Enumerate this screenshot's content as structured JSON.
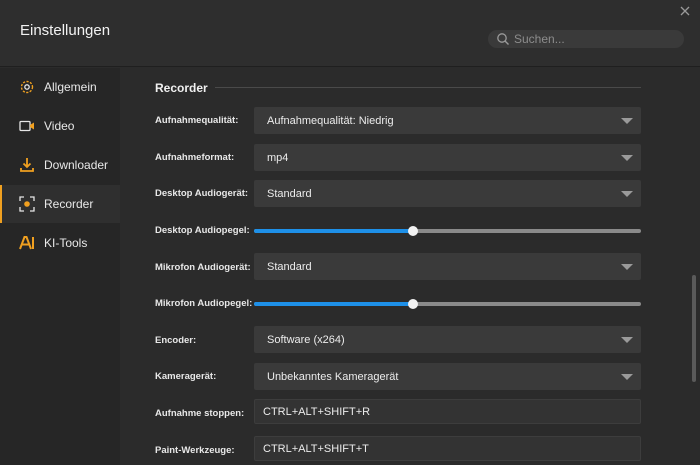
{
  "window": {
    "title": "Einstellungen"
  },
  "search": {
    "placeholder": "Suchen..."
  },
  "sidebar": {
    "items": [
      {
        "label": "Allgemein",
        "icon": "gear-icon"
      },
      {
        "label": "Video",
        "icon": "video-icon"
      },
      {
        "label": "Downloader",
        "icon": "download-icon"
      },
      {
        "label": "Recorder",
        "icon": "recorder-icon",
        "active": true
      },
      {
        "label": "KI-Tools",
        "icon": "ai-icon"
      }
    ]
  },
  "colors": {
    "accent": "#f0a020",
    "slider_fill": "#1e90e8"
  },
  "recorder": {
    "section_title": "Recorder",
    "rows": {
      "quality": {
        "label": "Aufnahmequalität:",
        "value": "Aufnahmequalität: Niedrig"
      },
      "format": {
        "label": "Aufnahmeformat:",
        "value": "mp4"
      },
      "desktop_audio_device": {
        "label": "Desktop Audiogerät:",
        "value": "Standard"
      },
      "desktop_audio_level": {
        "label": "Desktop Audiopegel:",
        "level": 0.41
      },
      "mic_audio_device": {
        "label": "Mikrofon Audiogerät:",
        "value": "Standard"
      },
      "mic_audio_level": {
        "label": "Mikrofon Audiopegel:",
        "level": 0.41
      },
      "encoder": {
        "label": "Encoder:",
        "value": "Software (x264)"
      },
      "camera": {
        "label": "Kameragerät:",
        "value": "Unbekanntes Kameragerät"
      },
      "stop_hotkey": {
        "label": "Aufnahme stoppen:",
        "value": "CTRL+ALT+SHIFT+R"
      },
      "paint_hotkey": {
        "label": "Paint-Werkzeuge:",
        "value": "CTRL+ALT+SHIFT+T"
      }
    }
  }
}
